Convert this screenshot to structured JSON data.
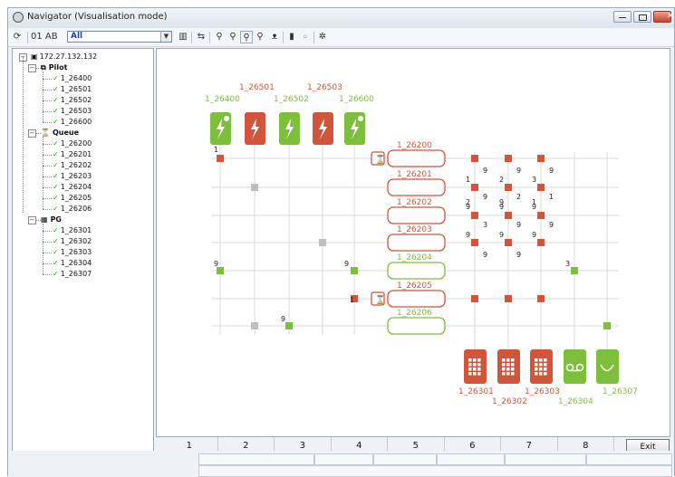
{
  "window": {
    "title": "Navigator (Visualisation mode)"
  },
  "toolbar": {
    "mode_label": "01 AB",
    "filter_value": "All"
  },
  "tree": {
    "root": "172.27.132.132",
    "groups": [
      {
        "label": "Pilot",
        "items": [
          "1_26400",
          "1_26501",
          "1_26502",
          "1_26503",
          "1_26600"
        ]
      },
      {
        "label": "Queue",
        "items": [
          "1_26200",
          "1_26201",
          "1_26202",
          "1_26203",
          "1_26204",
          "1_26205",
          "1_26206"
        ]
      },
      {
        "label": "PG",
        "items": [
          "1_26301",
          "1_26302",
          "1_26303",
          "1_26304",
          "1_26307"
        ]
      }
    ]
  },
  "diagram": {
    "colors": {
      "green": "#7dbe3c",
      "red": "#d0553a",
      "grey": "#bdbdbd",
      "line": "#d9d9d9"
    },
    "pilots": [
      {
        "id": "1_26400",
        "color": "green",
        "icon": "bolt-gear-icon"
      },
      {
        "id": "1_26501",
        "color": "red",
        "icon": "bolt-icon"
      },
      {
        "id": "1_26502",
        "color": "green",
        "icon": "bolt-icon"
      },
      {
        "id": "1_26503",
        "color": "red",
        "icon": "bolt-icon"
      },
      {
        "id": "1_26600",
        "color": "green",
        "icon": "bolt-gear-icon"
      }
    ],
    "queues": [
      {
        "id": "1_26200",
        "color": "red",
        "timer": true
      },
      {
        "id": "1_26201",
        "color": "red",
        "timer": false
      },
      {
        "id": "1_26202",
        "color": "red",
        "timer": false
      },
      {
        "id": "1_26203",
        "color": "red",
        "timer": false
      },
      {
        "id": "1_26204",
        "color": "green",
        "timer": false
      },
      {
        "id": "1_26205",
        "color": "red",
        "timer": true
      },
      {
        "id": "1_26206",
        "color": "green",
        "timer": false
      }
    ],
    "pgs": [
      {
        "id": "1_26301",
        "color": "red",
        "icon": "keypad-icon"
      },
      {
        "id": "1_26302",
        "color": "red",
        "icon": "keypad-icon"
      },
      {
        "id": "1_26303",
        "color": "red",
        "icon": "keypad-icon"
      },
      {
        "id": "1_26304",
        "color": "green",
        "icon": "voicemail-icon"
      },
      {
        "id": "1_26307",
        "color": "green",
        "icon": "smile-icon"
      }
    ],
    "node_numbers": [
      "1",
      "9",
      "9",
      "1",
      "9",
      "1",
      "9",
      "2",
      "9",
      "3",
      "9",
      "9",
      "9",
      "9",
      "2",
      "9",
      "1",
      "9",
      "3",
      "9",
      "9",
      "9",
      "9",
      "3",
      "9",
      "2",
      "9",
      "1",
      "9",
      "9",
      "9",
      "9",
      "9"
    ]
  },
  "tabs": [
    "1",
    "2",
    "3",
    "4",
    "5",
    "6",
    "7",
    "8"
  ],
  "exit_label": "Exit"
}
